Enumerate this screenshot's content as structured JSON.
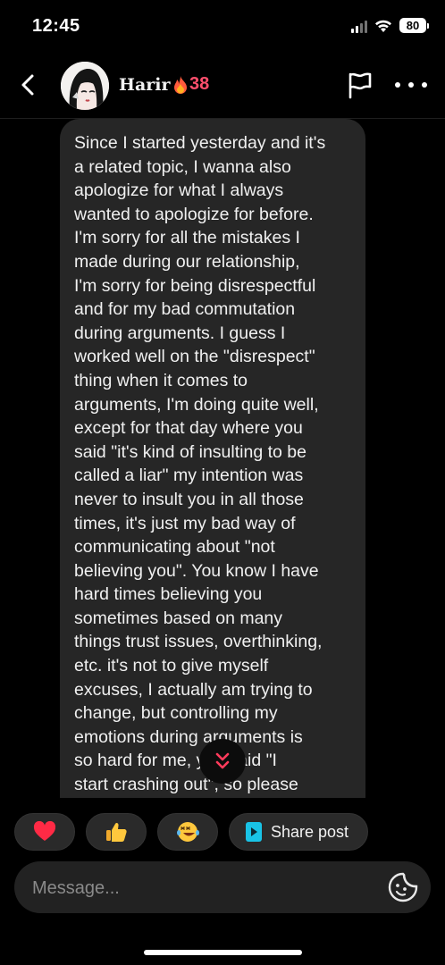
{
  "status_bar": {
    "time": "12:45",
    "battery": "80",
    "icons": [
      "signal-icon",
      "wifi-icon",
      "battery-icon"
    ]
  },
  "header": {
    "username": "Harir",
    "streak_icon": "fire-icon",
    "streak_count": "38",
    "icons": [
      "back-icon",
      "flag-icon",
      "more-icon"
    ]
  },
  "message": {
    "text": "Since I started yesterday and it's\na related topic, I wanna also\napologize for what I always\nwanted to apologize for before.\nI'm sorry for all the mistakes I\nmade during our relationship,\nI'm sorry for being disrespectful\nand for my bad commutation\nduring arguments. I guess I\nworked well on the \"disrespect\"\nthing when it comes to\narguments, I'm doing quite well,\nexcept for that day where you\nsaid \"it's kind of insulting to be\ncalled a liar\" my intention was\nnever to insult you in all those\ntimes, it's just my bad way of\ncommunicating about \"not\nbelieving you\". You know I have\nhard times believing you\nsometimes based on many\nthings trust issues, overthinking,\netc. it's not to give myself\nexcuses, I actually am trying to\nchange, but controlling my\nemotions during arguments is\nso hard for me, you said \"I\nstart crashing out\", so please"
  },
  "reactions": [
    {
      "icon": "heart-icon"
    },
    {
      "icon": "thumbs-up-icon"
    },
    {
      "icon": "laughing-face-icon"
    }
  ],
  "share": {
    "label": "Share post",
    "icon": "share-post-icon"
  },
  "composer": {
    "placeholder": "Message...",
    "icon": "sticker-icon"
  },
  "colors": {
    "background": "#000000",
    "bubble": "#262626",
    "streak": "#ff4f6d",
    "scroll_arrow": "#ff3b5c",
    "share_icon": "#19c3e6"
  }
}
